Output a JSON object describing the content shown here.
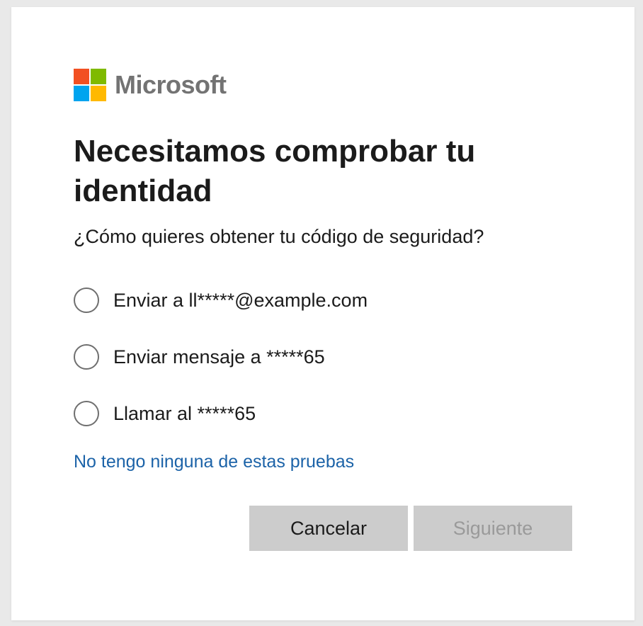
{
  "brand": {
    "name": "Microsoft",
    "logo_colors": [
      "#f25022",
      "#7fba00",
      "#00a4ef",
      "#ffb900"
    ]
  },
  "title": "Necesitamos comprobar tu identidad",
  "subtitle": "¿Cómo quieres obtener tu código de seguridad?",
  "options": [
    {
      "label": "Enviar a ll*****@example.com",
      "selected": false
    },
    {
      "label": "Enviar mensaje a *****65",
      "selected": false
    },
    {
      "label": "Llamar al *****65",
      "selected": false
    }
  ],
  "no_proofs_link": "No tengo ninguna de estas pruebas",
  "buttons": {
    "cancel": "Cancelar",
    "next": "Siguiente",
    "next_enabled": false
  },
  "colors": {
    "link": "#1c63a8",
    "button_bg": "#cccccc"
  }
}
